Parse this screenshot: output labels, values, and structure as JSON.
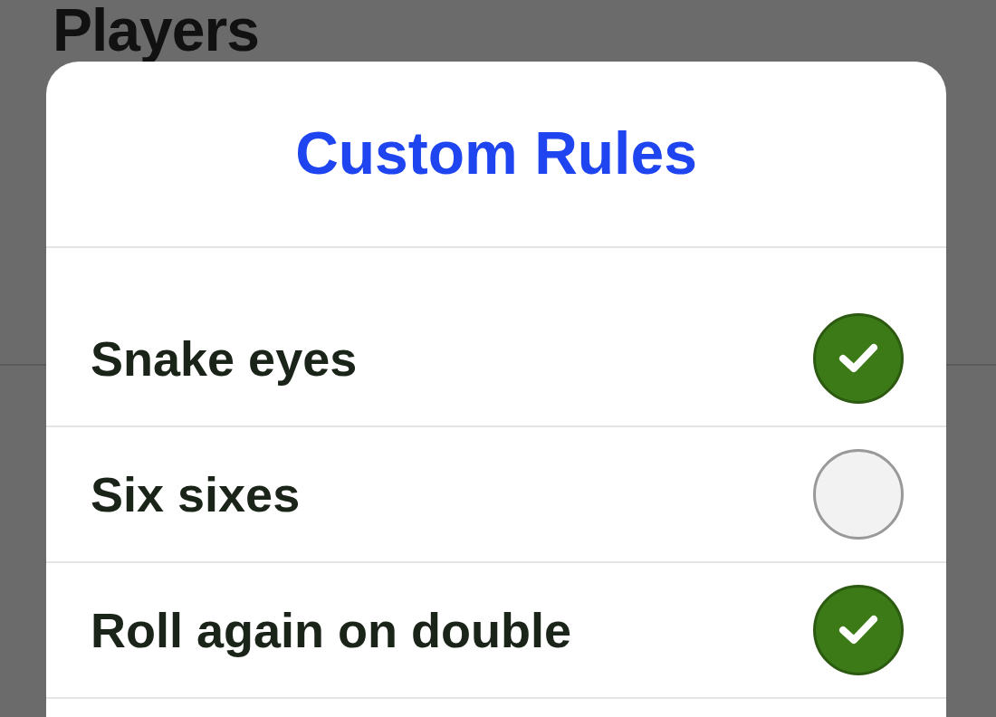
{
  "page": {
    "title": "Players"
  },
  "dialog": {
    "title": "Custom Rules",
    "rules": [
      {
        "label": "Snake eyes",
        "checked": true
      },
      {
        "label": "Six sixes",
        "checked": false
      },
      {
        "label": "Roll again on double",
        "checked": true
      }
    ]
  }
}
